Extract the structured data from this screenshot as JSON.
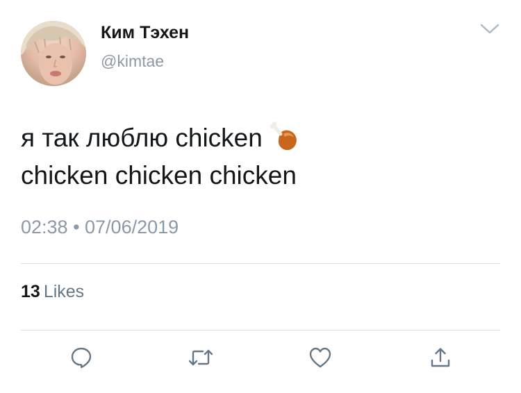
{
  "author": {
    "display_name": "Ким Тэхен",
    "handle": "@kimtae"
  },
  "tweet": {
    "line1": "я так люблю chicken",
    "line2": "chicken chicken chicken",
    "emoji": "poultry-leg"
  },
  "meta": {
    "timestamp": "02:38 • 07/06/2019"
  },
  "engagement": {
    "likes_count": "13",
    "likes_label": "Likes"
  },
  "actions": {
    "icons": [
      "reply-icon",
      "retweet-icon",
      "like-icon",
      "share-icon"
    ]
  },
  "colors": {
    "text_primary": "#14171a",
    "text_secondary": "#8b98a5",
    "icon": "#657786",
    "divider": "#d9dfe4"
  }
}
